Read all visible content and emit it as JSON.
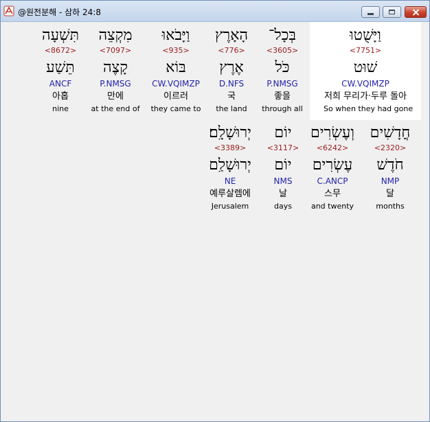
{
  "window": {
    "title": "@원전분해 - 삼하 24:8"
  },
  "words": [
    {
      "hebrew": "וַיָּשֻׁטוּ",
      "strongs": "<7751>",
      "lemma": "שׁוּט",
      "parsing": "CW.VQIMZP",
      "korean": "저희 무리가·두루 돌아",
      "english": "So when they had gone"
    },
    {
      "hebrew": "בְּכָל־",
      "strongs": "<3605>",
      "lemma": "כֹּל",
      "parsing": "P.NMSG",
      "korean": "좋을",
      "english": "through all"
    },
    {
      "hebrew": "הָאָרֶץ",
      "strongs": "<776>",
      "lemma": "אֶרֶץ",
      "parsing": "D.NFS",
      "korean": "국",
      "english": "the land"
    },
    {
      "hebrew": "וַיָּבֹאוּ",
      "strongs": "<935>",
      "lemma": "בּוֹא",
      "parsing": "CW.VQIMZP",
      "korean": "이르러",
      "english": "they came to"
    },
    {
      "hebrew": "מִקְצֵה",
      "strongs": "<7097>",
      "lemma": "קָצֶה",
      "parsing": "P.NMSG",
      "korean": "만에",
      "english": "at the end of"
    },
    {
      "hebrew": "תִּשְׁעָה",
      "strongs": "<8672>",
      "lemma": "תֵּשַׁע",
      "parsing": "ANCF",
      "korean": "아홉",
      "english": "nine"
    },
    {
      "hebrew": "חֳדָשִׁים",
      "strongs": "<2320>",
      "lemma": "חֹדֶשׁ",
      "parsing": "NMP",
      "korean": "달",
      "english": "months"
    },
    {
      "hebrew": "וְעֶשְׂרִים",
      "strongs": "<6242>",
      "lemma": "עֶשְׂרִים",
      "parsing": "C.ANCP",
      "korean": "스무",
      "english": "and twenty"
    },
    {
      "hebrew": "יוֹם",
      "strongs": "<3117>",
      "lemma": "יוֹם",
      "parsing": "NMS",
      "korean": "날",
      "english": "days"
    },
    {
      "hebrew": "יְרוּשָׁלִָם׃",
      "strongs": "<3389>",
      "lemma": "יְרוּשָׁלִַם",
      "parsing": "NE",
      "korean": "예루살렘에",
      "english": "Jerusalem"
    }
  ],
  "colors": {
    "strongs": "#9a1a1a",
    "parsing": "#2323a8",
    "selection_background": "#ffffff"
  }
}
